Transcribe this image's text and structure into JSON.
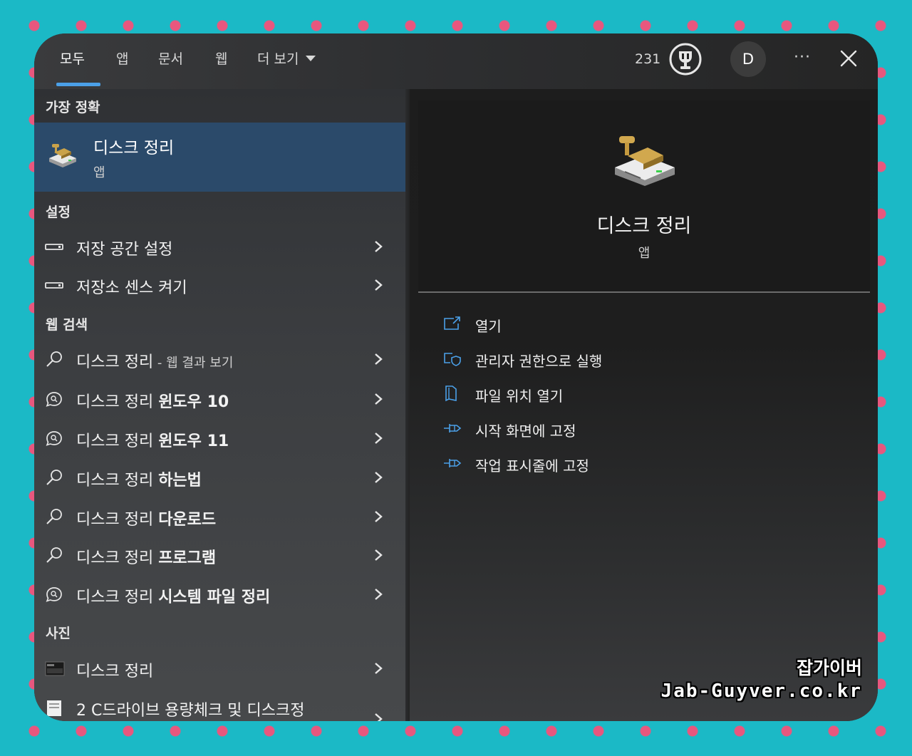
{
  "tabs": [
    {
      "label": "모두",
      "active": true
    },
    {
      "label": "앱"
    },
    {
      "label": "문서"
    },
    {
      "label": "웹"
    },
    {
      "label": "더 보기"
    }
  ],
  "header": {
    "points": "231",
    "avatar_initial": "D",
    "more": "···"
  },
  "sections": {
    "best": "가장 정확",
    "settings": "설정",
    "web": "웹 검색",
    "photos": "사진"
  },
  "best_match": {
    "title": "디스크 정리",
    "subtitle": "앱",
    "icon": "disk-cleanup-icon"
  },
  "settings_items": [
    {
      "label": "저장 공간 설정",
      "icon": "storage-icon"
    },
    {
      "label": "저장소 센스 켜기",
      "icon": "storage-icon"
    }
  ],
  "web_items": [
    {
      "label": "디스크 정리",
      "suffix": " - 웹 결과 보기",
      "icon": "search-icon"
    },
    {
      "label": "디스크 정리 ",
      "bold": "윈도우 10",
      "icon": "chat-search-icon"
    },
    {
      "label": "디스크 정리 ",
      "bold": "윈도우 11",
      "icon": "chat-search-icon"
    },
    {
      "label": "디스크 정리 ",
      "bold": "하는법",
      "icon": "search-icon"
    },
    {
      "label": "디스크 정리 ",
      "bold": "다운로드",
      "icon": "search-icon"
    },
    {
      "label": "디스크 정리 ",
      "bold": "프로그램",
      "icon": "search-icon"
    },
    {
      "label": "디스크 정리 ",
      "bold": "시스템 파일 정리",
      "icon": "chat-search-icon"
    }
  ],
  "photo_items": [
    {
      "label": "디스크 정리",
      "icon": "photo-thumbnail-icon"
    },
    {
      "label": "2 C드라이브 용량체크 및 디스크정",
      "icon": "photo-thumbnail-icon"
    }
  ],
  "preview": {
    "title": "디스크 정리",
    "subtitle": "앱"
  },
  "actions": [
    {
      "label": "열기",
      "icon": "open-icon"
    },
    {
      "label": "관리자 권한으로 실행",
      "icon": "admin-shield-icon"
    },
    {
      "label": "파일 위치 열기",
      "icon": "folder-location-icon"
    },
    {
      "label": "시작 화면에 고정",
      "icon": "pin-icon"
    },
    {
      "label": "작업 표시줄에 고정",
      "icon": "pin-icon"
    }
  ],
  "watermark": {
    "line1": "잡가이버",
    "line2": "Jab-Guyver.co.kr"
  },
  "colors": {
    "accent": "#4ba0e8",
    "selected": "#2b4a6a",
    "bg_teal": "#1bb9c6",
    "dot_pink": "#e8577e"
  }
}
